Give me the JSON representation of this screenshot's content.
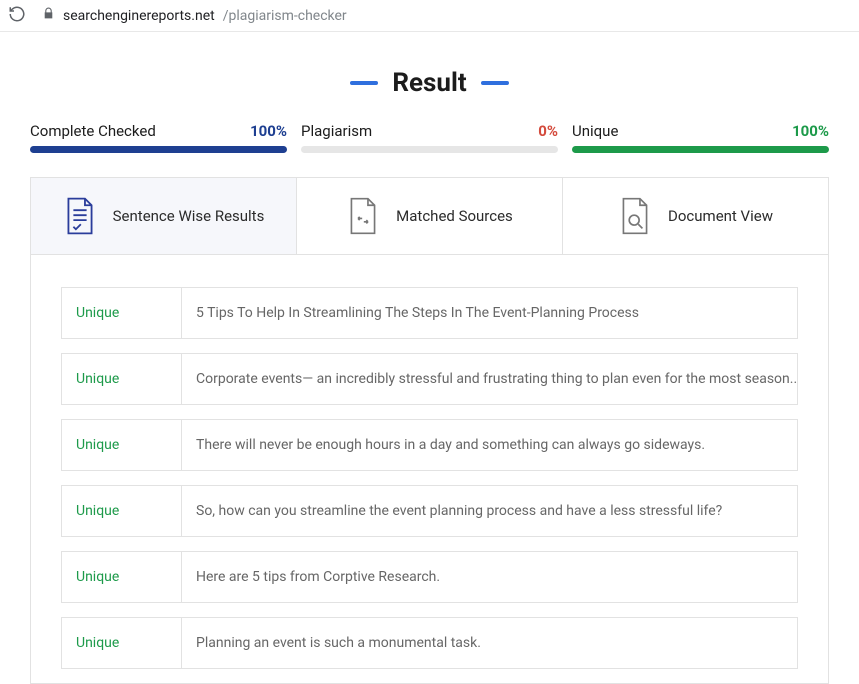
{
  "browser": {
    "url_host": "searchenginereports.net",
    "url_path": "/plagiarism-checker"
  },
  "header": {
    "title": "Result"
  },
  "stats": {
    "checked": {
      "label": "Complete Checked",
      "value": "100%"
    },
    "plagiarism": {
      "label": "Plagiarism",
      "value": "0%"
    },
    "unique": {
      "label": "Unique",
      "value": "100%"
    }
  },
  "tabs": {
    "sentence": "Sentence Wise Results",
    "sources": "Matched Sources",
    "document": "Document View"
  },
  "rows": [
    {
      "status": "Unique",
      "text": "5 Tips To Help In Streamlining The Steps In The Event-Planning Process"
    },
    {
      "status": "Unique",
      "text": "Corporate events— an incredibly stressful and frustrating thing to plan even for the most season..."
    },
    {
      "status": "Unique",
      "text": "There will never be enough hours in a day and something can always go sideways."
    },
    {
      "status": "Unique",
      "text": "So, how can you streamline the event planning process and have a less stressful life?"
    },
    {
      "status": "Unique",
      "text": "Here are 5 tips from Corptive Research."
    },
    {
      "status": "Unique",
      "text": "Planning an event is such a monumental task."
    }
  ]
}
